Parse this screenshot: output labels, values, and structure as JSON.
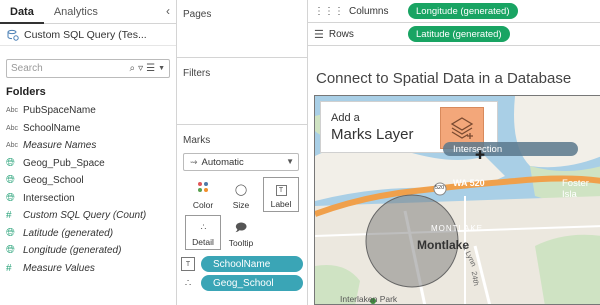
{
  "data_pane": {
    "tabs": [
      {
        "label": "Data",
        "active": true
      },
      {
        "label": "Analytics",
        "active": false
      }
    ],
    "collapse_icon": "chevron-left-icon",
    "data_source": "Custom SQL Query (Tes...",
    "search_placeholder": "Search",
    "folders_label": "Folders",
    "fields": [
      {
        "type": "Abc",
        "name": "PubSpaceName",
        "italic": false
      },
      {
        "type": "Abc",
        "name": "SchoolName",
        "italic": false
      },
      {
        "type": "Abc",
        "name": "Measure Names",
        "italic": true
      },
      {
        "type": "geo",
        "name": "Geog_Pub_Space",
        "italic": false
      },
      {
        "type": "geo",
        "name": "Geog_School",
        "italic": false
      },
      {
        "type": "geo",
        "name": "Intersection",
        "italic": false
      },
      {
        "type": "#",
        "name": "Custom SQL Query (Count)",
        "italic": true
      },
      {
        "type": "geo",
        "name": "Latitude (generated)",
        "italic": true
      },
      {
        "type": "geo",
        "name": "Longitude (generated)",
        "italic": true
      },
      {
        "type": "#",
        "name": "Measure Values",
        "italic": true
      }
    ]
  },
  "shelves": {
    "pages_label": "Pages",
    "filters_label": "Filters",
    "marks_label": "Marks",
    "mark_type": "Automatic",
    "mark_buttons": [
      "Color",
      "Size",
      "Label",
      "Detail",
      "Tooltip"
    ],
    "mark_pills": [
      {
        "icon": "T",
        "label": "SchoolName"
      },
      {
        "icon": "dots",
        "label": "Geog_School"
      }
    ]
  },
  "view": {
    "columns_label": "Columns",
    "rows_label": "Rows",
    "columns_pill": "Longitude (generated)",
    "rows_pill": "Latitude (generated)",
    "sheet_title": "Connect to Spatial Data in a Database",
    "callout_line1": "Add a",
    "callout_line2": "Marks Layer",
    "drag_pill": "Intersection",
    "map_labels": {
      "highway": "WA 520",
      "highway_shield": "520",
      "foster": "Foster Isla",
      "montlake_small": "MONTLAKE",
      "montlake": "Montlake",
      "park": "Interlaken Park",
      "street1": "E Lynn",
      "street2": "24th"
    }
  },
  "colors": {
    "accent_teal": "#3aa5b6",
    "pill_green": "#19a463",
    "water": "#a9cfe6",
    "layer_orange": "#f3a77a"
  }
}
